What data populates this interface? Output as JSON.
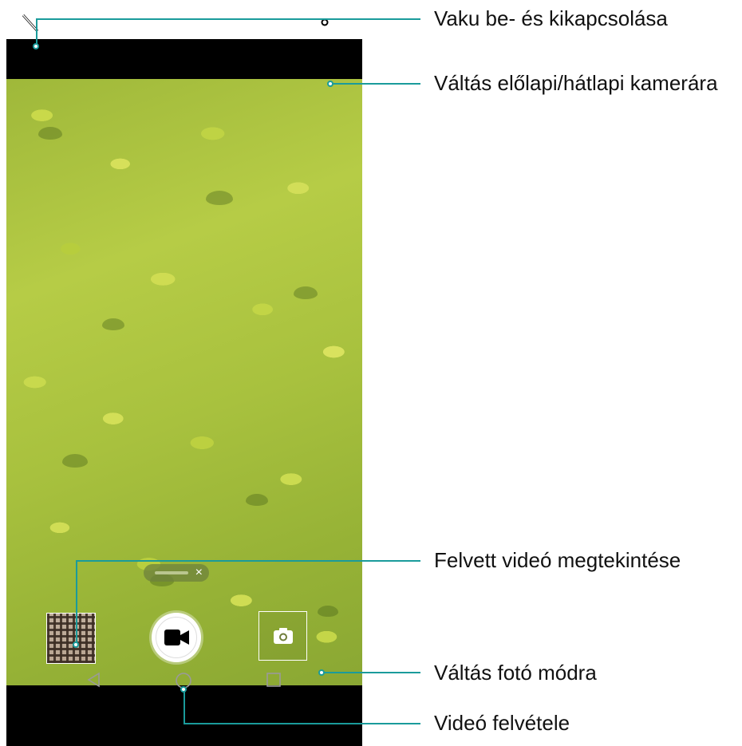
{
  "annotations": {
    "flash": "Vaku be- és kikapcsolása",
    "switch_camera": "Váltás előlapi/hátlapi kamerára",
    "view_video": "Felvett videó megtekintése",
    "photo_mode": "Váltás fotó módra",
    "record": "Videó felvétele"
  },
  "icons": {
    "flash": "flash-off-icon",
    "switch_camera": "switch-camera-icon",
    "record": "video-camera-icon",
    "photo_mode": "camera-icon",
    "nav_back": "back-triangle-icon",
    "nav_home": "home-circle-icon",
    "nav_recent": "recent-square-icon",
    "zoom_close": "close-icon"
  },
  "colors": {
    "callout": "#1a9b9b",
    "foliage": "#b6cc46"
  }
}
